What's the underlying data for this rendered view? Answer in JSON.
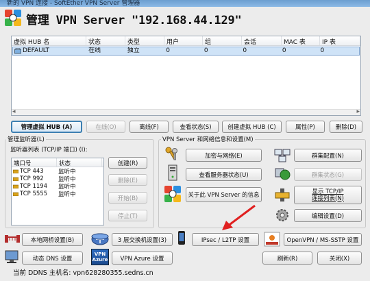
{
  "window": {
    "titlebar_text": "新的 VPN 连接 - SoftEther VPN Server 管理器",
    "header_title": "管理 VPN Server \"192.168.44.129\""
  },
  "hub_table": {
    "columns": [
      "虚拟 HUB 名",
      "状态",
      "类型",
      "用户",
      "组",
      "会话",
      "MAC 表",
      "IP 表"
    ],
    "rows": [
      [
        "DEFAULT",
        "在线",
        "独立",
        "0",
        "0",
        "0",
        "0",
        "0"
      ]
    ]
  },
  "hub_buttons": {
    "manage": "管理虚拟 HUB (A)",
    "online": "在线(O)",
    "offline": "离线(F)",
    "status": "查看状态(S)",
    "create": "创建虚拟 HUB (C)",
    "properties": "属性(P)",
    "delete": "删除(D)"
  },
  "listener": {
    "group_title": "管理监听器(L)",
    "list_title": "监听器列表 (TCP/IP 端口) (I):",
    "columns": [
      "端口号",
      "状态"
    ],
    "rows": [
      [
        "TCP 443",
        "监听中"
      ],
      [
        "TCP 992",
        "监听中"
      ],
      [
        "TCP 1194",
        "监听中"
      ],
      [
        "TCP 5555",
        "监听中"
      ]
    ],
    "buttons": {
      "create": "创建(R)",
      "delete": "删除(E)",
      "start": "开始(B)",
      "stop": "停止(T)"
    }
  },
  "server_info": {
    "group_title": "VPN Server 和网络信息和设置(M)",
    "encryption": "加密与网络(E)",
    "server_status": "查看服务器状态(U)",
    "about": "关于此 VPN Server 的信息",
    "cluster_config": "群集配置(N)",
    "cluster_status": "群集状态(G)",
    "tcp_list_line1": "显示 TCP/IP",
    "tcp_list_line2": "连接列表(N)",
    "edit_config": "编辑设置(D)"
  },
  "bottom": {
    "local_bridge": "本地网桥设置(B)",
    "l3_switch": "3 层交换机设置(3)",
    "ipsec": "IPsec / L2TP 设置",
    "openvpn": "OpenVPN / MS-SSTP 设置",
    "ddns": "动态 DNS 设置",
    "azure": "VPN Azure 设置",
    "refresh": "刷新(R)",
    "close": "关闭(X)",
    "azure_icon_line1": "VPN",
    "azure_icon_line2": "Azure"
  },
  "status_bar": {
    "text": "当前 DDNS 主机名: vpn628280355.sedns.cn"
  }
}
